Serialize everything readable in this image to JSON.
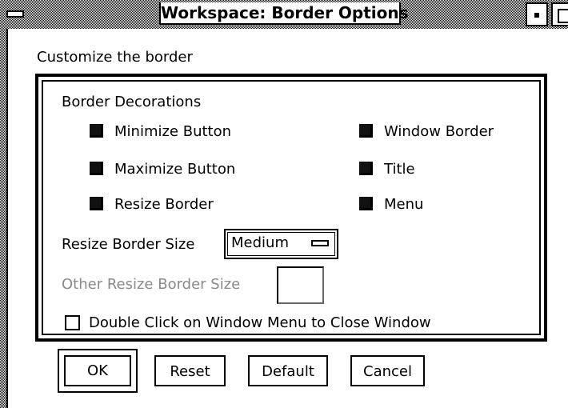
{
  "window": {
    "title": "Workspace: Border Options"
  },
  "dialog": {
    "heading": "Customize the border",
    "group_label": "Border Decorations",
    "decorations": [
      {
        "label": "Minimize Button",
        "checked": true
      },
      {
        "label": "Maximize Button",
        "checked": true
      },
      {
        "label": "Resize Border",
        "checked": true
      },
      {
        "label": "Window Border",
        "checked": true
      },
      {
        "label": "Title",
        "checked": true
      },
      {
        "label": "Menu",
        "checked": true
      }
    ],
    "resize_border_size": {
      "label": "Resize Border Size",
      "value": "Medium"
    },
    "other_resize_border_size": {
      "label": "Other Resize Border Size",
      "value": "",
      "enabled": false
    },
    "double_click": {
      "label": "Double Click on Window Menu to Close Window",
      "checked": false
    }
  },
  "buttons": {
    "ok": "OK",
    "reset": "Reset",
    "default": "Default",
    "cancel": "Cancel"
  }
}
